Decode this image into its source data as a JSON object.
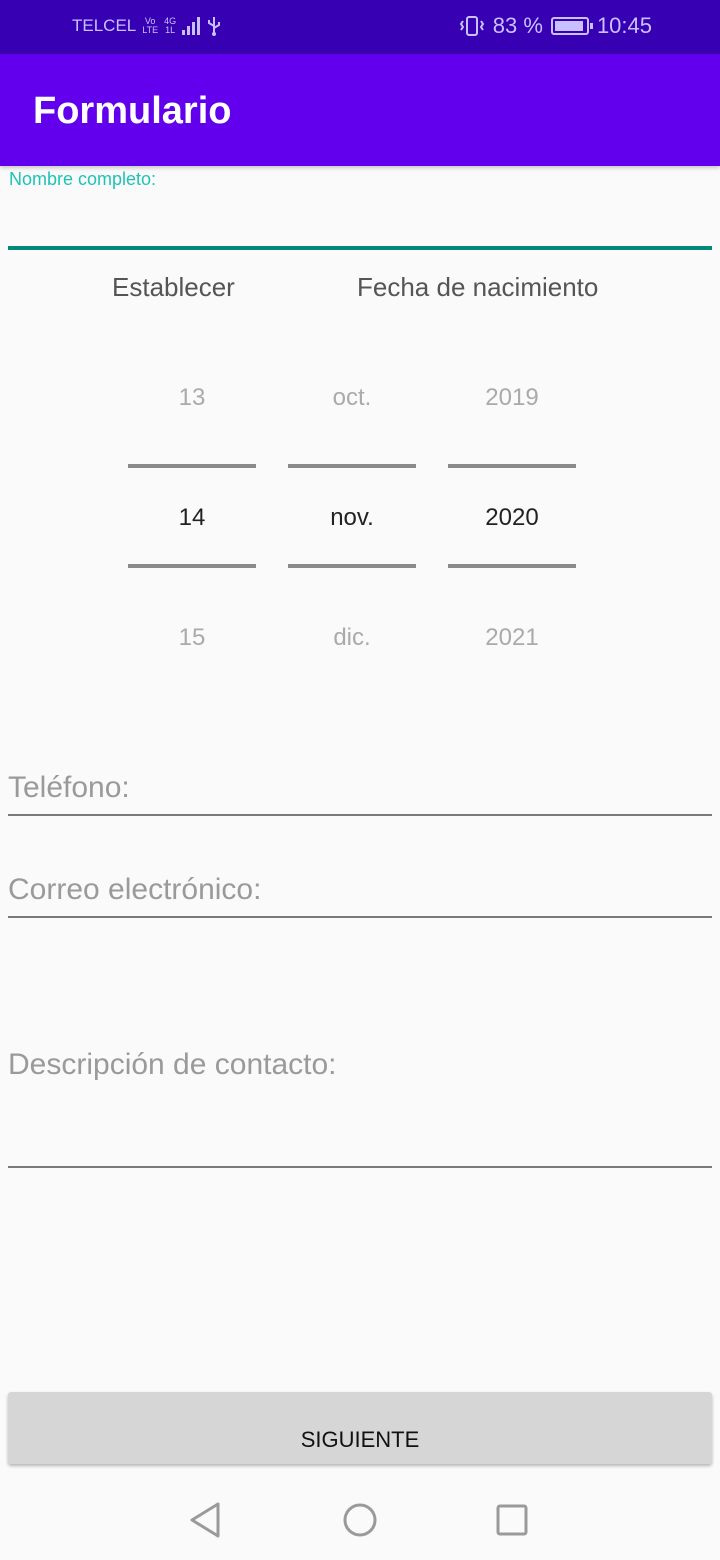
{
  "status_bar": {
    "carrier": "TELCEL",
    "volte_top": "Vo",
    "volte_bottom": "LTE",
    "network_top": "4G",
    "network_bottom": "1L",
    "battery": "83 %",
    "time": "10:45"
  },
  "app_bar": {
    "title": "Formulario"
  },
  "form": {
    "name_label": "Nombre completo:",
    "name_value": "",
    "date_header_left": "Establecer",
    "date_header_right": "Fecha de nacimiento",
    "date_picker": {
      "day": {
        "prev": "13",
        "current": "14",
        "next": "15"
      },
      "month": {
        "prev": "oct.",
        "current": "nov.",
        "next": "dic."
      },
      "year": {
        "prev": "2019",
        "current": "2020",
        "next": "2021"
      }
    },
    "phone_placeholder": "Teléfono:",
    "email_placeholder": "Correo electrónico:",
    "description_placeholder": "Descripción de contacto:",
    "next_button": "SIGUIENTE"
  },
  "colors": {
    "status_bar": "#3700b3",
    "app_bar": "#6200ee",
    "accent": "#00897b",
    "label_teal": "#1fc3b6"
  },
  "icons": {
    "nav": [
      "back-icon",
      "home-icon",
      "recent-apps-icon"
    ],
    "status": [
      "usb-icon",
      "vibrate-icon",
      "battery-icon",
      "signal-icon"
    ]
  }
}
